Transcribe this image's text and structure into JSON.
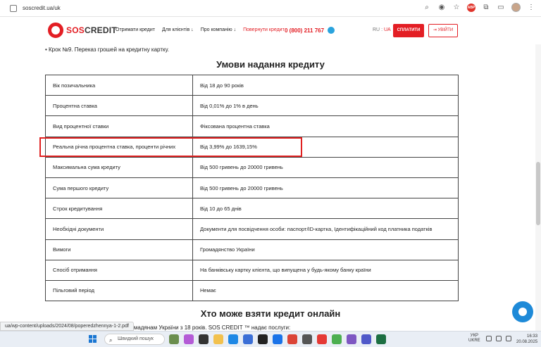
{
  "browser": {
    "url": "soscredit.ua/uk"
  },
  "header": {
    "logo_sos": "SOS",
    "logo_credit": "CREDIT",
    "nav": [
      "Отримати кредит",
      "Для клієнтів ↓",
      "Про компанію ↓",
      "Повернути кредит"
    ],
    "phone": "0 (800) 211 767",
    "lang_ru": "RU",
    "lang_sep": " : ",
    "lang_ua": "UA",
    "pay_label": "СПЛАТИТИ",
    "login_label": "УВІЙТИ"
  },
  "content": {
    "step_text": "• Крок №9. Переказ грошей на кредитну картку.",
    "section_title": "Умови надання кредиту",
    "rows": [
      {
        "k": "Вік позичальника",
        "v": "Від 18 до 90 років"
      },
      {
        "k": "Процентна ставка",
        "v": "Від 0,01% до 1% в день"
      },
      {
        "k": "Вид процентної ставки",
        "v": "Фіксована процентна ставка"
      },
      {
        "k": "Реальна річна процентна ставка, проценти річних",
        "v": "Від 3,99% до 1639,15%"
      },
      {
        "k": "Максимальна сума кредиту",
        "v": "Від 500 гривень до 20000 гривень"
      },
      {
        "k": "Сума першого кредиту",
        "v": "Від 500 гривень до 20000 гривень"
      },
      {
        "k": "Строк кредитування",
        "v": "Від 10 до 65 днів"
      },
      {
        "k": "Необхідні документи",
        "v": "Документи для посвідчення особи: паспорт/ID-картка, Ідентифікаційний код платника податків"
      },
      {
        "k": "Вимоги",
        "v": "Громадянство України"
      },
      {
        "k": "Спосіб отримання",
        "v": "На банківську картку клієнта, що випущена у будь-якому банку країни"
      },
      {
        "k": "Пільговий період",
        "v": "Немає"
      }
    ],
    "section2_title": "Хто може взяти кредит онлайн",
    "cut_text": "…громадянам України з 18 років. SOS CREDIT ™ надає послуги:",
    "status_link": "ua/wp-content/uploads/2024/08/poperedzhennya-1-2.pdf",
    "left_fragment": "nny"
  },
  "taskbar": {
    "search_placeholder": "Швидкий пошук",
    "lang_top": "УКР",
    "lang_bottom": "UKRE",
    "time": "16:33",
    "date": "20.08.2025"
  }
}
